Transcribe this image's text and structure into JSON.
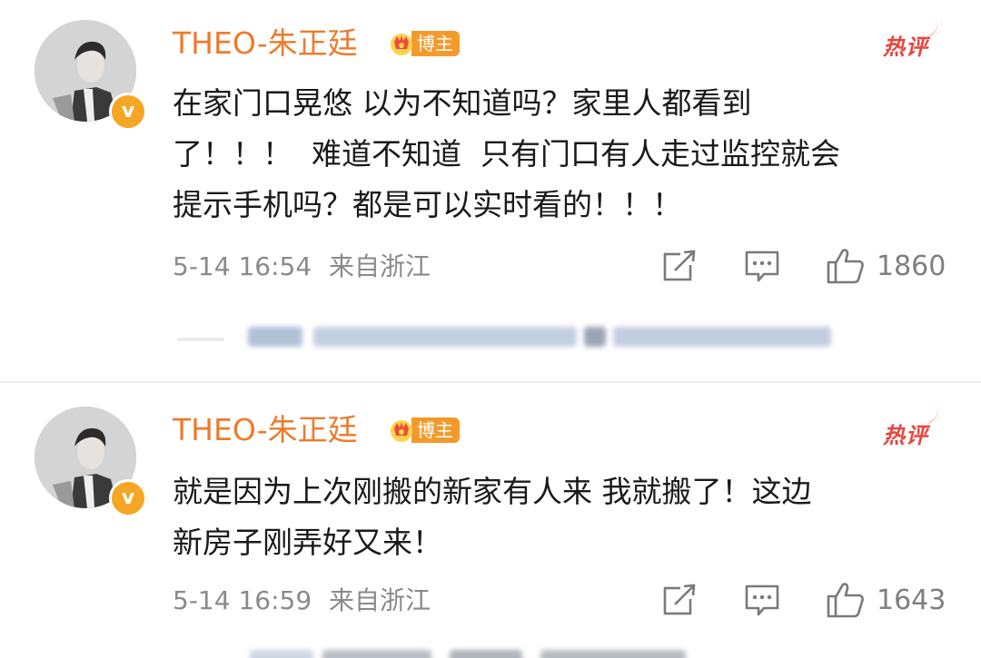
{
  "comments": [
    {
      "username": "THEO-朱正廷",
      "role_badge": "博主",
      "hot_label": "热评",
      "verified_mark": "v",
      "text": "在家门口晃悠 以为不知道吗？家里人都看到\n了！！！  难道不知道  只有门口有人走过监控就会\n提示手机吗？都是可以实时看的！！！",
      "timestamp": "5-14 16:54",
      "location": "来自浙江",
      "likes": "1860"
    },
    {
      "username": "THEO-朱正廷",
      "role_badge": "博主",
      "hot_label": "热评",
      "verified_mark": "v",
      "text": "就是因为上次刚搬的新家有人来 我就搬了！这边\n新房子刚弄好又来！",
      "timestamp": "5-14 16:59",
      "location": "来自浙江",
      "likes": "1643"
    }
  ],
  "icons": {
    "repost": "repost-icon",
    "comment": "comment-icon",
    "like": "like-icon",
    "crown": "crown-icon"
  },
  "colors": {
    "username": "#ee7a2b",
    "badge": "#f39a2b",
    "hot": "#e8453c",
    "meta": "#8a8a8a",
    "verified": "#f5a623"
  }
}
